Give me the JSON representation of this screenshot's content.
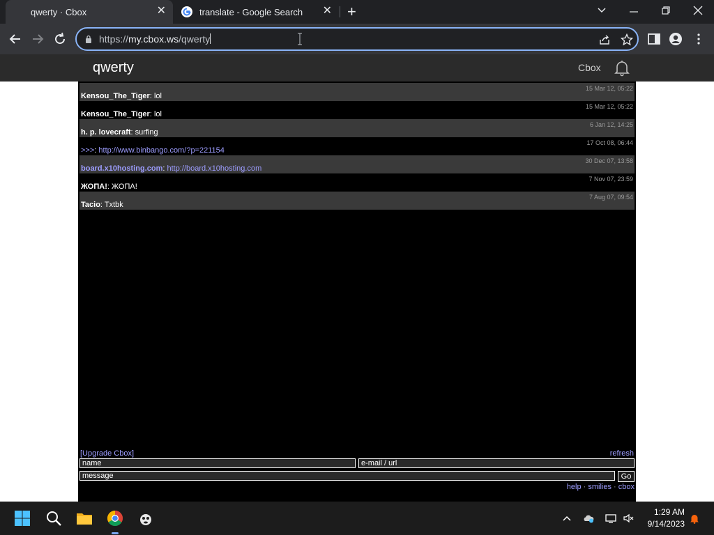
{
  "browser": {
    "tabs": [
      {
        "title": "qwerty · Cbox",
        "active": true
      },
      {
        "title": "translate - Google Search",
        "active": false
      }
    ],
    "close_glyph": "✕",
    "new_tab_glyph": "+",
    "address": {
      "scheme": "https://",
      "host": "my.cbox.ws",
      "path": "/qwerty"
    }
  },
  "page": {
    "title": "qwerty",
    "brand": "Cbox"
  },
  "messages": [
    {
      "name": "Kensou_The_Tiger",
      "sep": ": ",
      "text": "lol",
      "time": "15 Mar 12, 05:22",
      "name_link": false,
      "text_link": false
    },
    {
      "name": "Kensou_The_Tiger",
      "sep": ": ",
      "text": "lol",
      "time": "15 Mar 12, 05:22",
      "name_link": false,
      "text_link": false
    },
    {
      "name": "h. p. lovecraft",
      "sep": ": ",
      "text": "surfing",
      "time": "6 Jan 12, 14:25",
      "name_link": false,
      "text_link": false
    },
    {
      "name": ">>>",
      "sep": ": ",
      "text": "http://www.binbango.com/?p=221154",
      "time": "17 Oct 08, 06:44",
      "name_link": false,
      "text_link": true
    },
    {
      "name": "board.x10hosting.com",
      "sep": ": ",
      "text": "http://board.x10hosting.com",
      "time": "30 Dec 07, 13:58",
      "name_link": true,
      "text_link": true
    },
    {
      "name": "ЖОПА!",
      "sep": ": ",
      "text": "ЖОПА!",
      "time": "7 Nov 07, 23:59",
      "name_link": false,
      "text_link": false
    },
    {
      "name": "Tacio",
      "sep": ": ",
      "text": "Txtbk",
      "time": "7 Aug 07, 09:54",
      "name_link": false,
      "text_link": false
    }
  ],
  "form": {
    "upgrade_label": "[Upgrade Cbox]",
    "refresh_label": "refresh",
    "name_placeholder": "name",
    "email_placeholder": "e-mail / url",
    "message_placeholder": "message",
    "go_label": "Go",
    "footer": {
      "help": "help",
      "smilies": "smilies",
      "cbox": "cbox",
      "separator": " · "
    }
  },
  "taskbar": {
    "time": "1:29 AM",
    "date": "9/14/2023"
  },
  "colors": {
    "accent": "#8ab4f8",
    "link": "#9d9dff",
    "row_alt": "#3a3a3a",
    "chat_bg": "#000000"
  }
}
